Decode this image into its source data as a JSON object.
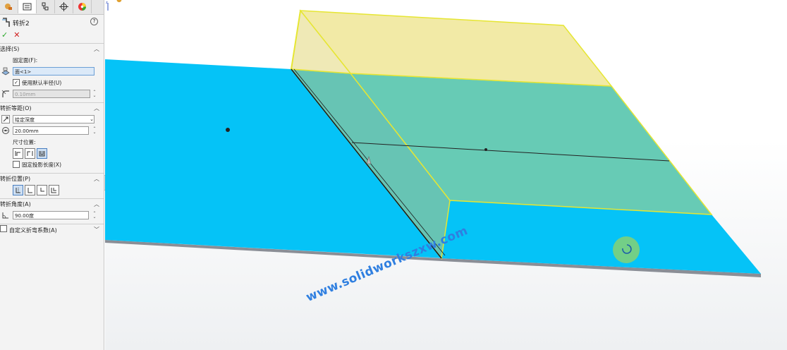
{
  "feature": {
    "title": "转折2",
    "help": "?"
  },
  "actions": {
    "ok": "✓",
    "cancel": "✕"
  },
  "selection": {
    "heading": "选择(S)",
    "fixed_face_label": "固定面(F):",
    "fixed_face_value": "面<1>",
    "use_default_radius_label": "使用默认半径(U)",
    "use_default_radius_checked": true,
    "radius_value": "0.10mm"
  },
  "bend_distance": {
    "heading": "转折等距(O)",
    "end_condition": "给定深度",
    "distance_value": "20.00mm",
    "dimension_position_label": "尺寸位置:",
    "fix_projected_length_label": "固定投影长度(X)",
    "fix_projected_length_checked": false
  },
  "bend_position": {
    "heading": "转折位置(P)"
  },
  "bend_angle": {
    "heading": "转折角度(A)",
    "angle_value": "90.00度"
  },
  "custom_bend": {
    "heading": "自定义折弯系数(A)"
  },
  "viewport": {
    "breadcrumb": "​",
    "watermark": "www.solidworkszxw.com",
    "colors": {
      "sheet": "#05c3f7",
      "preview_face": "#6acbb5",
      "preview_yellow": "#f3eaa6",
      "edge_highlight": "#eaea2a"
    }
  }
}
